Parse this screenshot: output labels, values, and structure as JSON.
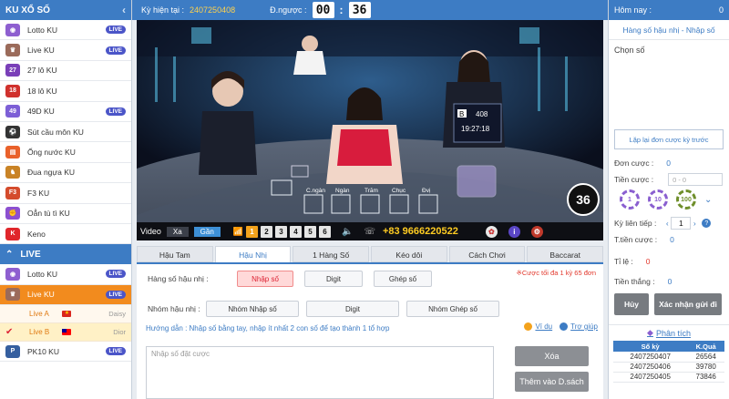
{
  "sidebar": {
    "header": "KU XỔ SỐ",
    "items": [
      {
        "label": "Lotto KU",
        "badge": "LIVE",
        "icon": "lotto-icon",
        "color": "#8e5fd0"
      },
      {
        "label": "Live KU",
        "badge": "LIVE",
        "icon": "live-ku-icon",
        "color": "#9b6b5a"
      },
      {
        "label": "27 lô KU",
        "badge": "",
        "icon": "27-lo-icon",
        "color": "#7a3fb8"
      },
      {
        "label": "18 lô KU",
        "badge": "",
        "icon": "18-lo-icon",
        "color": "#d0312d"
      },
      {
        "label": "49D KU",
        "badge": "LIVE",
        "icon": "49d-icon",
        "color": "#7d5fd6"
      },
      {
        "label": "Sút cầu môn KU",
        "badge": "",
        "icon": "soccer-icon",
        "color": "#333333"
      },
      {
        "label": "Ống nước KU",
        "badge": "",
        "icon": "pipe-icon",
        "color": "#e9612a"
      },
      {
        "label": "Đua ngựa KU",
        "badge": "",
        "icon": "horse-icon",
        "color": "#c98326"
      },
      {
        "label": "F3 KU",
        "badge": "",
        "icon": "f3-icon",
        "color": "#d44b2c"
      },
      {
        "label": "Oẳn tù tì KU",
        "badge": "",
        "icon": "rock-paper-icon",
        "color": "#8c4fd0"
      },
      {
        "label": "Keno",
        "badge": "",
        "icon": "keno-icon",
        "color": "#e0262b"
      }
    ],
    "live_header": "LIVE",
    "live_items": [
      {
        "label": "Lotto KU",
        "badge": "LIVE",
        "icon": "lotto-live-icon",
        "color": "#8e5fd0"
      },
      {
        "label": "Live KU",
        "badge": "LIVE",
        "icon": "live-ku-live-icon",
        "color": "#9b6b5a"
      }
    ],
    "sub_items": [
      {
        "label": "Live A",
        "dealer": "Daisy",
        "flag": "vietnam-flag-icon"
      },
      {
        "label": "Live B",
        "dealer": "Dior",
        "flag": "taiwan-flag-icon"
      }
    ],
    "last_item": {
      "label": "PK10 KU",
      "badge": "LIVE"
    }
  },
  "topbar": {
    "period_label": "Kỳ hiện tại :",
    "period_value": "2407250408",
    "countdown_label": "Đ.ngược :",
    "minutes": "00",
    "seconds": "36"
  },
  "video": {
    "countdown": "36",
    "table_labels": [
      "C.ngàn",
      "Ngàn",
      "Trăm",
      "Chục",
      "Đvị"
    ],
    "screen": {
      "badge": "B",
      "id": "408",
      "time": "19:27:18"
    },
    "controls": {
      "label": "Video",
      "buttons": [
        "Xa",
        "Gần"
      ],
      "numbers": [
        "1",
        "2",
        "3",
        "4",
        "5",
        "6"
      ],
      "phone": "+83 9666220522"
    }
  },
  "tabs": [
    "Hậu Tam",
    "Hậu Nhị",
    "1 Hàng Số",
    "Kéo dôi",
    "Cách Chơi",
    "Baccarat"
  ],
  "active_tab": 1,
  "panel": {
    "row1_label": "Hàng số hậu nhị :",
    "row1_buttons": [
      "Nhập số",
      "Digit",
      "Ghép số"
    ],
    "note": "※Cược tối đa 1 kỳ 65 đơn",
    "row2_label": "Nhóm hậu nhị :",
    "row2_buttons": [
      "Nhóm Nhập số",
      "Digit",
      "Nhóm Ghép số"
    ],
    "hint": "Hướng dẫn : Nhập số bằng tay, nhập ít nhất 2 con số để tạo thành 1 tổ hợp",
    "link_example": "Ví dụ",
    "link_help": "Trợ giúp",
    "textarea_placeholder": "Nhập số đặt cược",
    "btn_delete": "Xóa",
    "btn_add": "Thêm vào D.sách"
  },
  "right": {
    "today_label": "Hôm nay :",
    "today_value": "0",
    "title": "Hàng số hậu nhị - Nhập số",
    "choose": "Chọn số",
    "repeat_btn": "Lặp lại đơn cược kỳ trước",
    "don_cuoc_label": "Đơn cược :",
    "don_cuoc_value": "0",
    "tien_cuoc_label": "Tiền cược :",
    "tien_cuoc_placeholder": "0 - 0",
    "chips": [
      {
        "v": "1",
        "c": "#8a5fd0"
      },
      {
        "v": "10",
        "c": "#8a5fd0"
      },
      {
        "v": "100",
        "c": "#6f8f2b"
      }
    ],
    "ky_lien_tiep_label": "Kỳ liên tiếp :",
    "ky_lien_tiep_value": "1",
    "t_tien_cuoc_label": "T.tiền cược :",
    "t_tien_cuoc_value": "0",
    "ti_le_label": "Tỉ lệ :",
    "ti_le_value": "0",
    "tien_thang_label": "Tiền thắng :",
    "tien_thang_value": "0",
    "btn_cancel": "Hủy",
    "btn_confirm": "Xác nhận gửi đi",
    "analysis": "Phân tích",
    "history_headers": [
      "Số kỳ",
      "K.Quả"
    ],
    "history": [
      [
        "2407250407",
        "26564"
      ],
      [
        "2407250406",
        "39780"
      ],
      [
        "2407250405",
        "73846"
      ]
    ]
  }
}
